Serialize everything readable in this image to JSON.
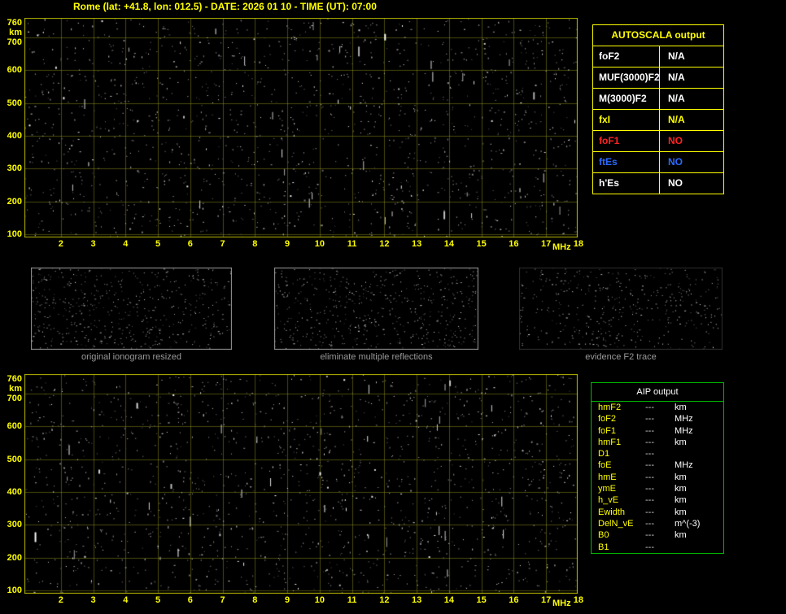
{
  "title": "Rome (lat: +41.8, lon: 012.5) - DATE: 2026 01 10 - TIME (UT): 07:00",
  "station": {
    "name": "Rome",
    "lat": "+41.8",
    "lon": "012.5",
    "date": "2026 01 10",
    "time_ut": "07:00"
  },
  "colors": {
    "background": "#000000",
    "axis_text": "#ffff00",
    "plot_border": "#b8b800",
    "grid": "#a0a020",
    "autoscala_border": "#ffff00",
    "aip_border": "#00b400",
    "caption_text": "#9a9a9a",
    "value_white": "#ffffff",
    "value_yellow": "#ffff00",
    "value_red": "#ff2222",
    "value_blue": "#2a6bff"
  },
  "ionogram_axes": {
    "y_unit": "km",
    "y_ticks": [
      760,
      700,
      600,
      500,
      400,
      300,
      200,
      100
    ],
    "y_range": [
      90,
      760
    ],
    "x_unit": "MHz",
    "x_ticks": [
      2,
      3,
      4,
      5,
      6,
      7,
      8,
      9,
      10,
      11,
      12,
      13,
      14,
      15,
      16,
      17,
      18
    ],
    "x_range": [
      1,
      18
    ]
  },
  "autoscala": {
    "header": "AUTOSCALA output",
    "rows": [
      {
        "param": "foF2",
        "value": "N/A",
        "color": "#ffffff"
      },
      {
        "param": "MUF(3000)F2",
        "value": "N/A",
        "color": "#ffffff"
      },
      {
        "param": "M(3000)F2",
        "value": "N/A",
        "color": "#ffffff"
      },
      {
        "param": "fxI",
        "value": "N/A",
        "color": "#ffff00"
      },
      {
        "param": "foF1",
        "value": "NO",
        "color": "#ff2222"
      },
      {
        "param": "ftEs",
        "value": "NO",
        "color": "#2a6bff"
      },
      {
        "param": "h'Es",
        "value": "NO",
        "color": "#ffffff"
      }
    ]
  },
  "thumbnails": [
    {
      "caption": "original ionogram resized"
    },
    {
      "caption": "eliminate multiple reflections"
    },
    {
      "caption": "evidence F2 trace"
    }
  ],
  "aip": {
    "header": "AIP output",
    "rows": [
      {
        "param": "hmF2",
        "value": "---",
        "unit": "km"
      },
      {
        "param": "foF2",
        "value": "---",
        "unit": "MHz"
      },
      {
        "param": "foF1",
        "value": "---",
        "unit": "MHz"
      },
      {
        "param": "hmF1",
        "value": "---",
        "unit": "km"
      },
      {
        "param": "D1",
        "value": "---",
        "unit": ""
      },
      {
        "param": "foE",
        "value": "---",
        "unit": "MHz"
      },
      {
        "param": "hmE",
        "value": "---",
        "unit": "km"
      },
      {
        "param": "ymE",
        "value": "---",
        "unit": "km"
      },
      {
        "param": "h_vE",
        "value": "---",
        "unit": "km"
      },
      {
        "param": "Ewidth",
        "value": "---",
        "unit": "km"
      },
      {
        "param": "DelN_vE",
        "value": "---",
        "unit": "m^(-3)"
      },
      {
        "param": "B0",
        "value": "---",
        "unit": "km"
      },
      {
        "param": "B1",
        "value": "---",
        "unit": ""
      }
    ]
  }
}
